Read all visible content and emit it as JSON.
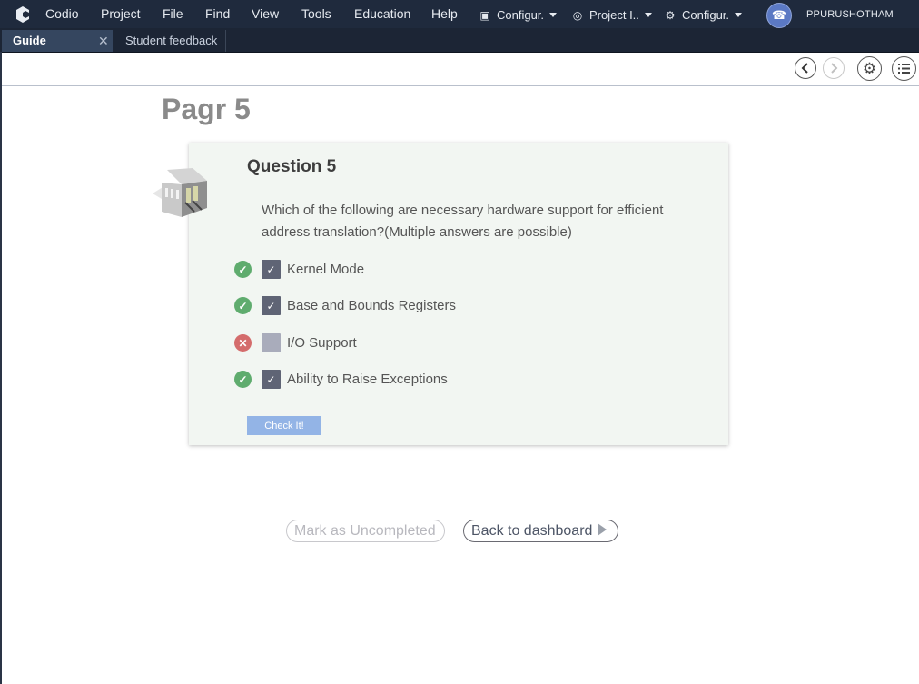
{
  "menubar": {
    "app_name": "Codio",
    "items": [
      "Project",
      "File",
      "Find",
      "View",
      "Tools",
      "Education",
      "Help"
    ],
    "dropdowns": [
      {
        "label": "Configur.",
        "icon": "terminal-icon"
      },
      {
        "label": "Project I..",
        "icon": "globe-icon"
      },
      {
        "label": "Configur.",
        "icon": "bug-icon"
      }
    ],
    "user": "PPURUSHOTHAM"
  },
  "tabs": [
    {
      "label": "Guide",
      "active": true
    },
    {
      "label": "Student feedback",
      "active": false
    }
  ],
  "page": {
    "title": "Pagr 5"
  },
  "question": {
    "title": "Question 5",
    "text": "Which of the following are necessary hardware support for efficient address translation?(Multiple answers are possible)",
    "options": [
      {
        "label": "Kernel Mode",
        "checked": true,
        "result": "correct"
      },
      {
        "label": "Base and Bounds Registers",
        "checked": true,
        "result": "correct"
      },
      {
        "label": "I/O Support",
        "checked": false,
        "result": "incorrect"
      },
      {
        "label": "Ability to Raise Exceptions",
        "checked": true,
        "result": "correct"
      }
    ],
    "check_button": "Check It!"
  },
  "footer": {
    "mark_uncompleted": "Mark as Uncompleted",
    "back_to_dashboard": "Back to dashboard"
  },
  "colors": {
    "menubar_bg": "#1f2a3d",
    "card_bg": "#f2f6f2",
    "correct": "#5fac6e",
    "incorrect": "#d46c6c",
    "check_button": "#93b4e6"
  }
}
